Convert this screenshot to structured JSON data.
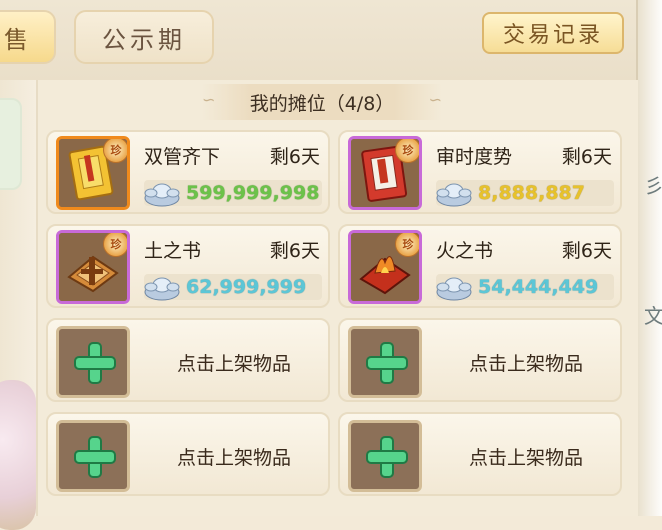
{
  "tabs": [
    {
      "label": "售",
      "active": true
    },
    {
      "label": "公示期",
      "active": false
    }
  ],
  "trade_log_button": "交易记录",
  "stall": {
    "title": "我的摊位（4/8）",
    "listed": [
      {
        "name": "双管齐下",
        "remaining": "剩6天",
        "price": "599,999,998",
        "price_color": "#6cc24a",
        "frame": "orange",
        "badge": "珍",
        "icon": "yellow-book-icon"
      },
      {
        "name": "审时度势",
        "remaining": "剩6天",
        "price": "8,888,887",
        "price_color": "#e7c22c",
        "frame": "purple",
        "badge": "珍",
        "icon": "red-book-icon"
      },
      {
        "name": "土之书",
        "remaining": "剩6天",
        "price": "62,999,999",
        "price_color": "#5cc6d6",
        "frame": "purple",
        "badge": "珍",
        "icon": "earth-scroll-icon"
      },
      {
        "name": "火之书",
        "remaining": "剩6天",
        "price": "54,444,449",
        "price_color": "#5cc6d6",
        "frame": "purple",
        "badge": "珍",
        "icon": "fire-scroll-icon"
      }
    ],
    "empty_slot_label": "点击上架物品"
  },
  "currency_icon": "silver-ingot-icon"
}
